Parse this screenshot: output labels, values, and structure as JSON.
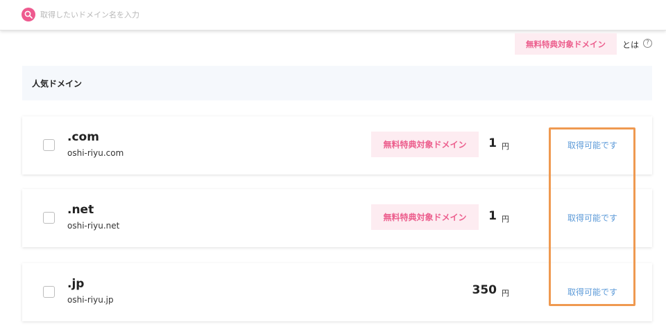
{
  "search": {
    "placeholder": "取得したいドメイン名を入力"
  },
  "info": {
    "badge_label": "無料特典対象ドメイン",
    "suffix": "とは",
    "help_glyph": "?"
  },
  "section": {
    "title": "人気ドメイン"
  },
  "domains": [
    {
      "tld": ".com",
      "domain": "oshi-riyu.com",
      "free_badge": "無料特典対象ドメイン",
      "price": "1",
      "currency": "円",
      "status": "取得可能です"
    },
    {
      "tld": ".net",
      "domain": "oshi-riyu.net",
      "free_badge": "無料特典対象ドメイン",
      "price": "1",
      "currency": "円",
      "status": "取得可能です"
    },
    {
      "tld": ".jp",
      "domain": "oshi-riyu.jp",
      "free_badge": "",
      "price": "350",
      "currency": "円",
      "status": "取得可能です"
    }
  ],
  "colors": {
    "accent_pink": "#ec5e8d",
    "badge_bg": "#fdecf1",
    "link_blue": "#5c9ad8",
    "highlight_orange": "#ef9950",
    "header_bg": "#f5f8fc"
  }
}
